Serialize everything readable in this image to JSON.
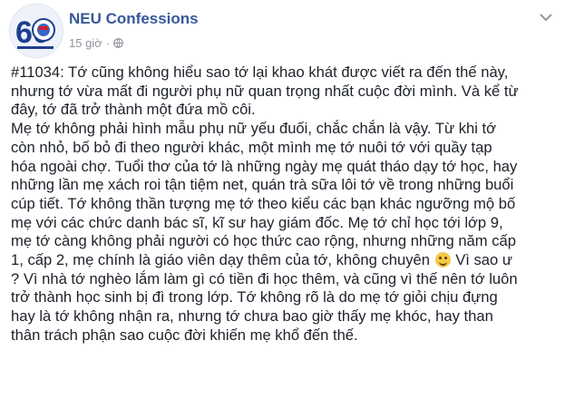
{
  "header": {
    "page_name": "NEU Confessions",
    "timestamp": "15 giờ",
    "separator": "·",
    "avatar_text": "60",
    "privacy_icon": "globe-icon",
    "menu_icon": "chevron-down-icon"
  },
  "post": {
    "lines": [
      "#11034: Tớ cũng không hiểu sao tớ lại khao khát được viết ra đến thế này,",
      "nhưng tớ vừa mất đi người phụ nữ quan trọng nhất cuộc đời mình. Và kể từ",
      "đây, tớ đã trở thành một đứa mồ côi.",
      "Mẹ tớ không phải hình mẫu phụ nữ yếu đuối, chắc chắn là vậy. Từ khi tớ",
      "còn nhỏ, bố bỏ đi theo người khác, một mình mẹ tớ nuôi tớ với quầy tạp",
      "hóa ngoài chợ. Tuổi thơ của tớ là những ngày mẹ quát tháo dạy tớ học, hay",
      "những lần mẹ xách roi tận tiệm net, quán trà sữa lôi tớ về trong những buổi",
      "cúp tiết. Tớ không thần tượng mẹ tớ theo kiểu các bạn khác ngưỡng mộ bố",
      "mẹ với các chức danh bác sĩ, kĩ sư hay giám đốc. Mẹ tớ chỉ học tới lớp 9,",
      "mẹ tớ càng không phải người có học thức cao rộng, nhưng những năm cấp",
      "1, cấp 2, mẹ chính là giáo viên dạy thêm của tớ, không chuyên",
      "Vì sao ư",
      "? Vì nhà tớ nghèo lắm làm gì có tiền đi học thêm, và cũng vì thế nên tớ luôn",
      "trở thành học sinh bị đì trong lớp. Tớ không rõ là do mẹ tớ giỏi chịu đựng",
      "hay là tớ không nhận ra, nhưng tớ chưa bao giờ thấy mẹ khóc, hay than",
      "thân trách phận sao cuộc đời khiến mẹ khổ đến thế."
    ],
    "emoji_icon": "smile-emoji-icon"
  }
}
